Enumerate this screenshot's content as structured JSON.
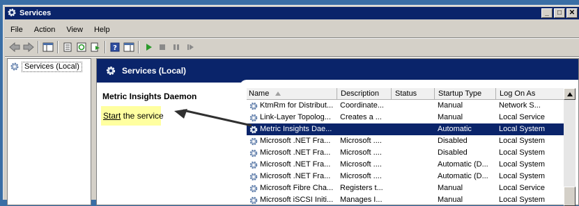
{
  "window": {
    "title": "Services"
  },
  "menu": [
    "File",
    "Action",
    "View",
    "Help"
  ],
  "tree": {
    "root_label": "Services (Local)"
  },
  "pane": {
    "header": "Services (Local)",
    "selected_service": "Metric Insights Daemon",
    "start_link": "Start",
    "start_rest": " the service"
  },
  "columns": [
    "Name",
    "Description",
    "Status",
    "Startup Type",
    "Log On As"
  ],
  "rows": [
    {
      "name": "KtmRm for Distribut...",
      "desc": "Coordinate...",
      "status": "",
      "startup": "Manual",
      "logon": "Network S..."
    },
    {
      "name": "Link-Layer Topolog...",
      "desc": "Creates a ...",
      "status": "",
      "startup": "Manual",
      "logon": "Local Service"
    },
    {
      "name": "Metric Insights Dae...",
      "desc": "",
      "status": "",
      "startup": "Automatic",
      "logon": "Local System",
      "selected": true
    },
    {
      "name": "Microsoft .NET Fra...",
      "desc": "Microsoft ....",
      "status": "",
      "startup": "Disabled",
      "logon": "Local System"
    },
    {
      "name": "Microsoft .NET Fra...",
      "desc": "Microsoft ....",
      "status": "",
      "startup": "Disabled",
      "logon": "Local System"
    },
    {
      "name": "Microsoft .NET Fra...",
      "desc": "Microsoft ....",
      "status": "",
      "startup": "Automatic (D...",
      "logon": "Local System"
    },
    {
      "name": "Microsoft .NET Fra...",
      "desc": "Microsoft ....",
      "status": "",
      "startup": "Automatic (D...",
      "logon": "Local System"
    },
    {
      "name": "Microsoft Fibre Cha...",
      "desc": "Registers t...",
      "status": "",
      "startup": "Manual",
      "logon": "Local Service"
    },
    {
      "name": "Microsoft iSCSI Initi...",
      "desc": "Manages I...",
      "status": "",
      "startup": "Manual",
      "logon": "Local System"
    }
  ],
  "colors": {
    "titlebar": "#0a246a",
    "selection": "#0a246a",
    "highlight": "#ffffa0"
  }
}
